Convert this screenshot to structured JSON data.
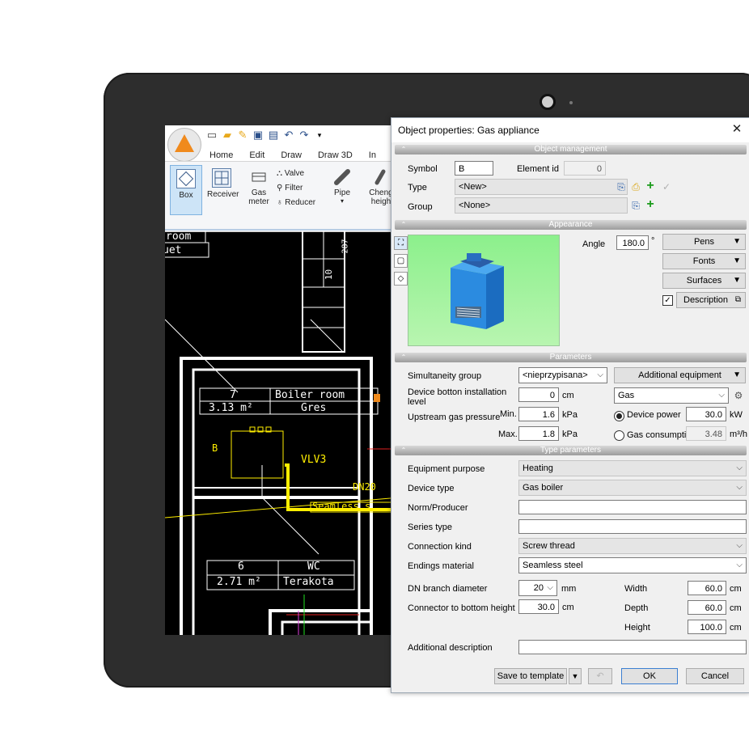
{
  "ribbon": {
    "tabs": [
      "Home",
      "Edit",
      "Draw",
      "Draw 3D",
      "In"
    ],
    "buttons": {
      "box": "Box",
      "receiver": "Receiver",
      "gas_meter": "Gas meter",
      "valve": "Valve",
      "filter": "Filter",
      "reducer": "Reducer",
      "pipe": "Pipe",
      "change_height": "Cheng heigh"
    }
  },
  "cad": {
    "room1": "room",
    "room2": "uet",
    "label_10": "10",
    "label_287": "287",
    "boiler_room_num": "7",
    "boiler_room_name": "Boiler room",
    "boiler_room_area": "3.13 m²",
    "boiler_room_floor": "Gres",
    "symbol_b": "B",
    "vlv": "VLV3",
    "dn": "DN20",
    "seamless": "Seamless s",
    "wc_num": "6",
    "wc_name": "WC",
    "wc_area": "2.71 m²",
    "wc_floor": "Terakota"
  },
  "dialog": {
    "title": "Object properties: Gas appliance",
    "sections": {
      "object_management": "Object management",
      "appearance": "Appearance",
      "parameters": "Parameters",
      "type_parameters": "Type parameters"
    },
    "symbol_label": "Symbol",
    "symbol_value": "B",
    "element_id_label": "Element id",
    "element_id_value": "0",
    "type_label": "Type",
    "type_value": "<New>",
    "group_label": "Group",
    "group_value": "<None>",
    "angle_label": "Angle",
    "angle_value": "180.0",
    "angle_unit": "°",
    "pens": "Pens",
    "fonts": "Fonts",
    "surfaces": "Surfaces",
    "description": "Description",
    "simultaneity_label": "Simultaneity group",
    "simultaneity_value": "<nieprzypisana>",
    "additional_equipment": "Additional equipment",
    "device_bottom_label": "Device botton installation level",
    "device_bottom_value": "0",
    "cm": "cm",
    "gas_value": "Gas",
    "upstream_label": "Upstream gas pressure",
    "min_label": "Min.",
    "min_value": "1.6",
    "max_label": "Max.",
    "max_value": "1.8",
    "kpa": "kPa",
    "device_power_label": "Device power",
    "device_power_value": "30.0",
    "kw": "kW",
    "gas_consumption_label": "Gas consumption",
    "gas_consumption_value": "3.48",
    "m3h": "m³/h",
    "equipment_purpose_label": "Equipment purpose",
    "equipment_purpose_value": "Heating",
    "device_type_label": "Device type",
    "device_type_value": "Gas boiler",
    "norm_label": "Norm/Producer",
    "norm_value": "",
    "series_label": "Series type",
    "series_value": "",
    "connection_kind_label": "Connection kind",
    "connection_kind_value": "Screw thread",
    "endings_label": "Endings material",
    "endings_value": "Seamless steel",
    "dn_label": "DN branch diameter",
    "dn_value": "20",
    "mm": "mm",
    "connector_label": "Connector to bottom height",
    "connector_value": "30.0",
    "width_label": "Width",
    "width_value": "60.0",
    "depth_label": "Depth",
    "depth_value": "60.0",
    "height_label": "Height",
    "height_value": "100.0",
    "additional_desc_label": "Additional description",
    "additional_desc_value": "",
    "save_template": "Save to template",
    "ok": "OK",
    "cancel": "Cancel"
  },
  "colors": {
    "accent": "#f08a1c",
    "section": "#a6a6a6",
    "yellow_pipe": "#ffee00",
    "ok_border": "#3c7fd1"
  }
}
